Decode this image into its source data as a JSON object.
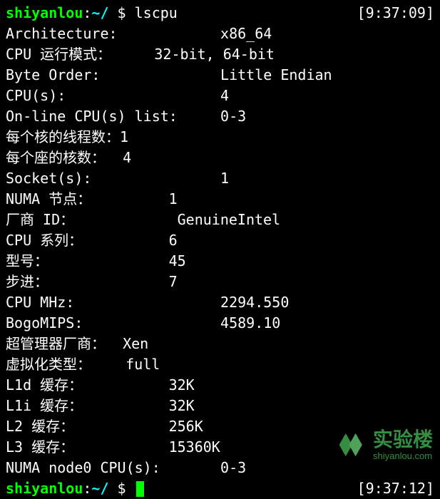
{
  "prompt1": {
    "user": "shiyanlou",
    "sep1": ":",
    "path": "~/",
    "dollar": " $ ",
    "command": "lscpu",
    "time": "[9:37:09]"
  },
  "rows": [
    {
      "label": "Architecture:",
      "pad": 12,
      "value": "x86_64"
    },
    {
      "label": "CPU 运行模式：",
      "pad": 5,
      "value": "32-bit, 64-bit"
    },
    {
      "label": "Byte Order:",
      "pad": 14,
      "value": "Little Endian"
    },
    {
      "label": "CPU(s):",
      "pad": 18,
      "value": "4"
    },
    {
      "label": "On-line CPU(s) list:",
      "pad": 5,
      "value": "0-3"
    },
    {
      "label": "每个核的线程数：",
      "pad": 0,
      "value": "1"
    },
    {
      "label": "每个座的核数：",
      "pad": 2,
      "value": "4"
    },
    {
      "label": "Socket(s):",
      "pad": 15,
      "value": "1"
    },
    {
      "label": "NUMA 节点：",
      "pad": 9,
      "value": "1"
    },
    {
      "label": "厂商 ID：",
      "pad": 12,
      "value": "GenuineIntel"
    },
    {
      "label": "CPU 系列：",
      "pad": 10,
      "value": "6"
    },
    {
      "label": "型号：",
      "pad": 14,
      "value": "45"
    },
    {
      "label": "步进：",
      "pad": 14,
      "value": "7"
    },
    {
      "label": "CPU MHz:",
      "pad": 17,
      "value": "2294.550"
    },
    {
      "label": "BogoMIPS:",
      "pad": 16,
      "value": "4589.10"
    },
    {
      "label": "超管理器厂商：",
      "pad": 2,
      "value": "Xen"
    },
    {
      "label": "虚拟化类型：",
      "pad": 4,
      "value": "full"
    },
    {
      "label": "L1d 缓存：",
      "pad": 10,
      "value": "32K"
    },
    {
      "label": "L1i 缓存：",
      "pad": 10,
      "value": "32K"
    },
    {
      "label": "L2 缓存：",
      "pad": 11,
      "value": "256K"
    },
    {
      "label": "L3 缓存：",
      "pad": 11,
      "value": "15360K"
    },
    {
      "label": "NUMA node0 CPU(s):",
      "pad": 7,
      "value": "0-3"
    }
  ],
  "prompt2": {
    "user": "shiyanlou",
    "sep1": ":",
    "path": "~/",
    "dollar": " $ ",
    "time": "[9:37:12]"
  },
  "watermark": {
    "cn": "实验楼",
    "url": "shiyanlou.com"
  }
}
